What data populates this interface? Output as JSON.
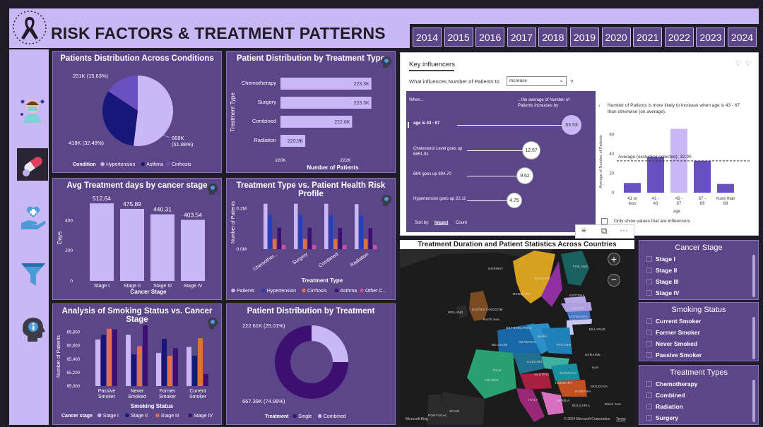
{
  "header": {
    "title": "RISK FACTORS & TREATMENT PATTERNS",
    "years": [
      "2014",
      "2015",
      "2016",
      "2017",
      "2018",
      "2019",
      "2020",
      "2021",
      "2022",
      "2023",
      "2024"
    ]
  },
  "colors": {
    "panel": "#5c468a",
    "light": "#c9b8f5",
    "navy": "#17177a",
    "mid": "#6a4fc0",
    "purple": "#3c0f70",
    "orange": "#e07040",
    "pink": "#d050a0",
    "blue": "#2040c0"
  },
  "pie": {
    "title": "Patients Distribution Across Conditions",
    "legend_label": "Condition",
    "labels": {
      "hypertension": "668K\n(51.88%)",
      "asthma": "418K (32.49%)",
      "cirrhosis": "201K (15.63%)"
    },
    "legend": [
      "Hypertension",
      "Asthma",
      "Cirrhosis"
    ]
  },
  "treat_type": {
    "title": "Patient Distribution by Treatment Type",
    "ylabel": "Treatment Type",
    "xlabel": "Number of Patients",
    "xticks": [
      "220K",
      "222K"
    ]
  },
  "stage_days": {
    "title": "Avg Treatment days by cancer stage",
    "ylabel": "Days",
    "xlabel": "Cancer Stage",
    "yticks": [
      "0",
      "200",
      "400"
    ]
  },
  "risk_profile": {
    "title": "Treatment Type vs. Patient Health Risk Profile",
    "ylabel": "Number of Patients",
    "xlabel": "Treatment Type",
    "yticks": [
      "0.0M",
      "0.2M"
    ],
    "legend": [
      "Patients",
      "Hypertension",
      "Cirrhosis",
      "Asthma",
      "Other C..."
    ]
  },
  "smoking": {
    "title": "Analysis of Smoking Status vs. Cancer Stage",
    "ylabel": "Number of Patients",
    "xlabel": "Smoking Status",
    "legend_label": "Cancer stage",
    "yticks": [
      "65,000",
      "65,200",
      "65,400",
      "65,600",
      "65,800"
    ],
    "legend": [
      "Stage I",
      "Stage II",
      "Stage III",
      "Stage IV"
    ]
  },
  "donut": {
    "title": "Patient Distribution by Treatment",
    "legend_label": "Treatment",
    "legend": [
      "Single",
      "Combined"
    ],
    "label_combined": "222.61K (25.01%)",
    "label_single": "667.39K (74.99%)"
  },
  "key_influencers": {
    "tab": "Key influencers",
    "question": "What influences Number of Patients to",
    "dropdown": "Increase",
    "qmark": "?",
    "when": "When...",
    "avg_header": "...the average of Number of Patients increases by",
    "rows": [
      {
        "label": "age is 43 - 67",
        "value": "53.53"
      },
      {
        "label": "Cholesterol Level goes up 6851.91",
        "value": "12.57"
      },
      {
        "label": "BMI goes up 894.70",
        "value": "9.62"
      },
      {
        "label": "Hypertension goes up 22.11",
        "value": "4.75"
      }
    ],
    "sort_by": "Sort by:",
    "sort_impact": "Impact",
    "sort_count": "Count",
    "detail_text": "Number of Patients is more likely to increase when age is 43 - 67 than otherwise (on average).",
    "avg_line": "Average (excluding selected): 32.90",
    "yaxis": "Average of Number of Patients",
    "xaxis": "age",
    "yticks": [
      "0",
      "20",
      "40",
      "60"
    ],
    "only_show": "Only show values that are influencers"
  },
  "map": {
    "title": "Treatment Duration and Patient Statistics Across Countries",
    "credit": "© 2024 Microsoft Corporation",
    "terms": "Terms",
    "logo": "Microsoft Bing",
    "places": [
      "NORWAY",
      "SWEDEN",
      "FINLAND",
      "ESTONIA",
      "LATVIA",
      "LITHUANIA",
      "BELARUS",
      "DENMARK",
      "UNITED KINGDOM",
      "IRELAND",
      "NETHERLANDS",
      "GERMANY",
      "BELGIUM",
      "POLAND",
      "UKRAINE",
      "FRANCE",
      "CZECHIA",
      "AUSTRIA",
      "SLOVAKIA",
      "HUNGARY",
      "ROMANIA",
      "MOLDOVA",
      "ITALY",
      "SERBIA",
      "BULGARIA",
      "SPAIN",
      "PORTUGAL",
      "Berlin",
      "Paris",
      "Kyiv",
      "North Sea",
      "Black Sea"
    ]
  },
  "slicers": {
    "cancer_stage": {
      "title": "Cancer Stage",
      "items": [
        "Stage I",
        "Stage II",
        "Stage III",
        "Stage IV"
      ]
    },
    "smoking_status": {
      "title": "Smoking Status",
      "items": [
        "Current Smoker",
        "Former Smoker",
        "Never Smoked",
        "Passive Smoker"
      ]
    },
    "treatment_types": {
      "title": "Treatment Types",
      "items": [
        "Chemotherapy",
        "Combined",
        "Radiation",
        "Surgery"
      ]
    }
  },
  "chart_data": [
    {
      "type": "pie",
      "title": "Patients Distribution Across Conditions",
      "categories": [
        "Hypertension",
        "Asthma",
        "Cirrhosis"
      ],
      "values": [
        668,
        418,
        201
      ],
      "percent": [
        51.88,
        32.49,
        15.63
      ],
      "unit": "K"
    },
    {
      "type": "bar",
      "orientation": "horizontal",
      "title": "Patient Distribution by Treatment Type",
      "categories": [
        "Chemotherapy",
        "Surgery",
        "Combined",
        "Radiation"
      ],
      "values": [
        223.3,
        223.3,
        222.6,
        220.9
      ],
      "data_labels": [
        "223.3K",
        "223.3K",
        "222.6K",
        "220.9K"
      ],
      "xlim": [
        220,
        224
      ],
      "unit": "K"
    },
    {
      "type": "bar",
      "title": "Avg Treatment days by cancer stage",
      "categories": [
        "Stage I",
        "Stage II",
        "Stage III",
        "Stage IV"
      ],
      "values": [
        512.64,
        475.89,
        440.31,
        403.54
      ],
      "ylim": [
        0,
        560
      ]
    },
    {
      "type": "bar",
      "title": "Treatment Type vs. Patient Health Risk Profile",
      "categories": [
        "Chemother...",
        "Surgery",
        "Combined",
        "Radiation"
      ],
      "series": [
        {
          "name": "Patients",
          "values": [
            0.223,
            0.223,
            0.223,
            0.221
          ]
        },
        {
          "name": "Hypertension",
          "values": [
            0.168,
            0.167,
            0.167,
            0.166
          ]
        },
        {
          "name": "Cirrhosis",
          "values": [
            0.05,
            0.05,
            0.05,
            0.05
          ]
        },
        {
          "name": "Asthma",
          "values": [
            0.105,
            0.105,
            0.104,
            0.103
          ]
        },
        {
          "name": "Other C...",
          "values": [
            0.02,
            0.02,
            0.02,
            0.02
          ]
        }
      ],
      "unit": "M",
      "ylim": [
        0,
        0.26
      ]
    },
    {
      "type": "bar",
      "title": "Analysis of Smoking Status vs. Cancer Stage",
      "categories": [
        "Passive Smoker",
        "Never Smoked",
        "Former Smoker",
        "Current Smoker"
      ],
      "series": [
        {
          "name": "Stage I",
          "values": [
            65690,
            65760,
            65490,
            65580
          ]
        },
        {
          "name": "Stage II",
          "values": [
            65760,
            65470,
            65700,
            65450
          ]
        },
        {
          "name": "Stage III",
          "values": [
            65850,
            65590,
            65450,
            65710
          ]
        },
        {
          "name": "Stage IV",
          "values": [
            65840,
            65900,
            65560,
            65180
          ]
        }
      ],
      "ylim": [
        65000,
        65900
      ]
    },
    {
      "type": "pie",
      "subtype": "donut",
      "title": "Patient Distribution by Treatment",
      "categories": [
        "Single",
        "Combined"
      ],
      "values": [
        667.39,
        222.61
      ],
      "percent": [
        74.99,
        25.01
      ],
      "unit": "K"
    },
    {
      "type": "bar",
      "title": "Key influencers detail",
      "xlabel": "age",
      "ylabel": "Average of Number of Patients",
      "categories": [
        "41 or less",
        "41 - 43",
        "43 - 67",
        "67 - 69",
        "more than 69"
      ],
      "values": [
        10,
        37,
        66,
        33,
        9
      ],
      "reference_line": 32.9,
      "ylim": [
        0,
        70
      ]
    }
  ]
}
